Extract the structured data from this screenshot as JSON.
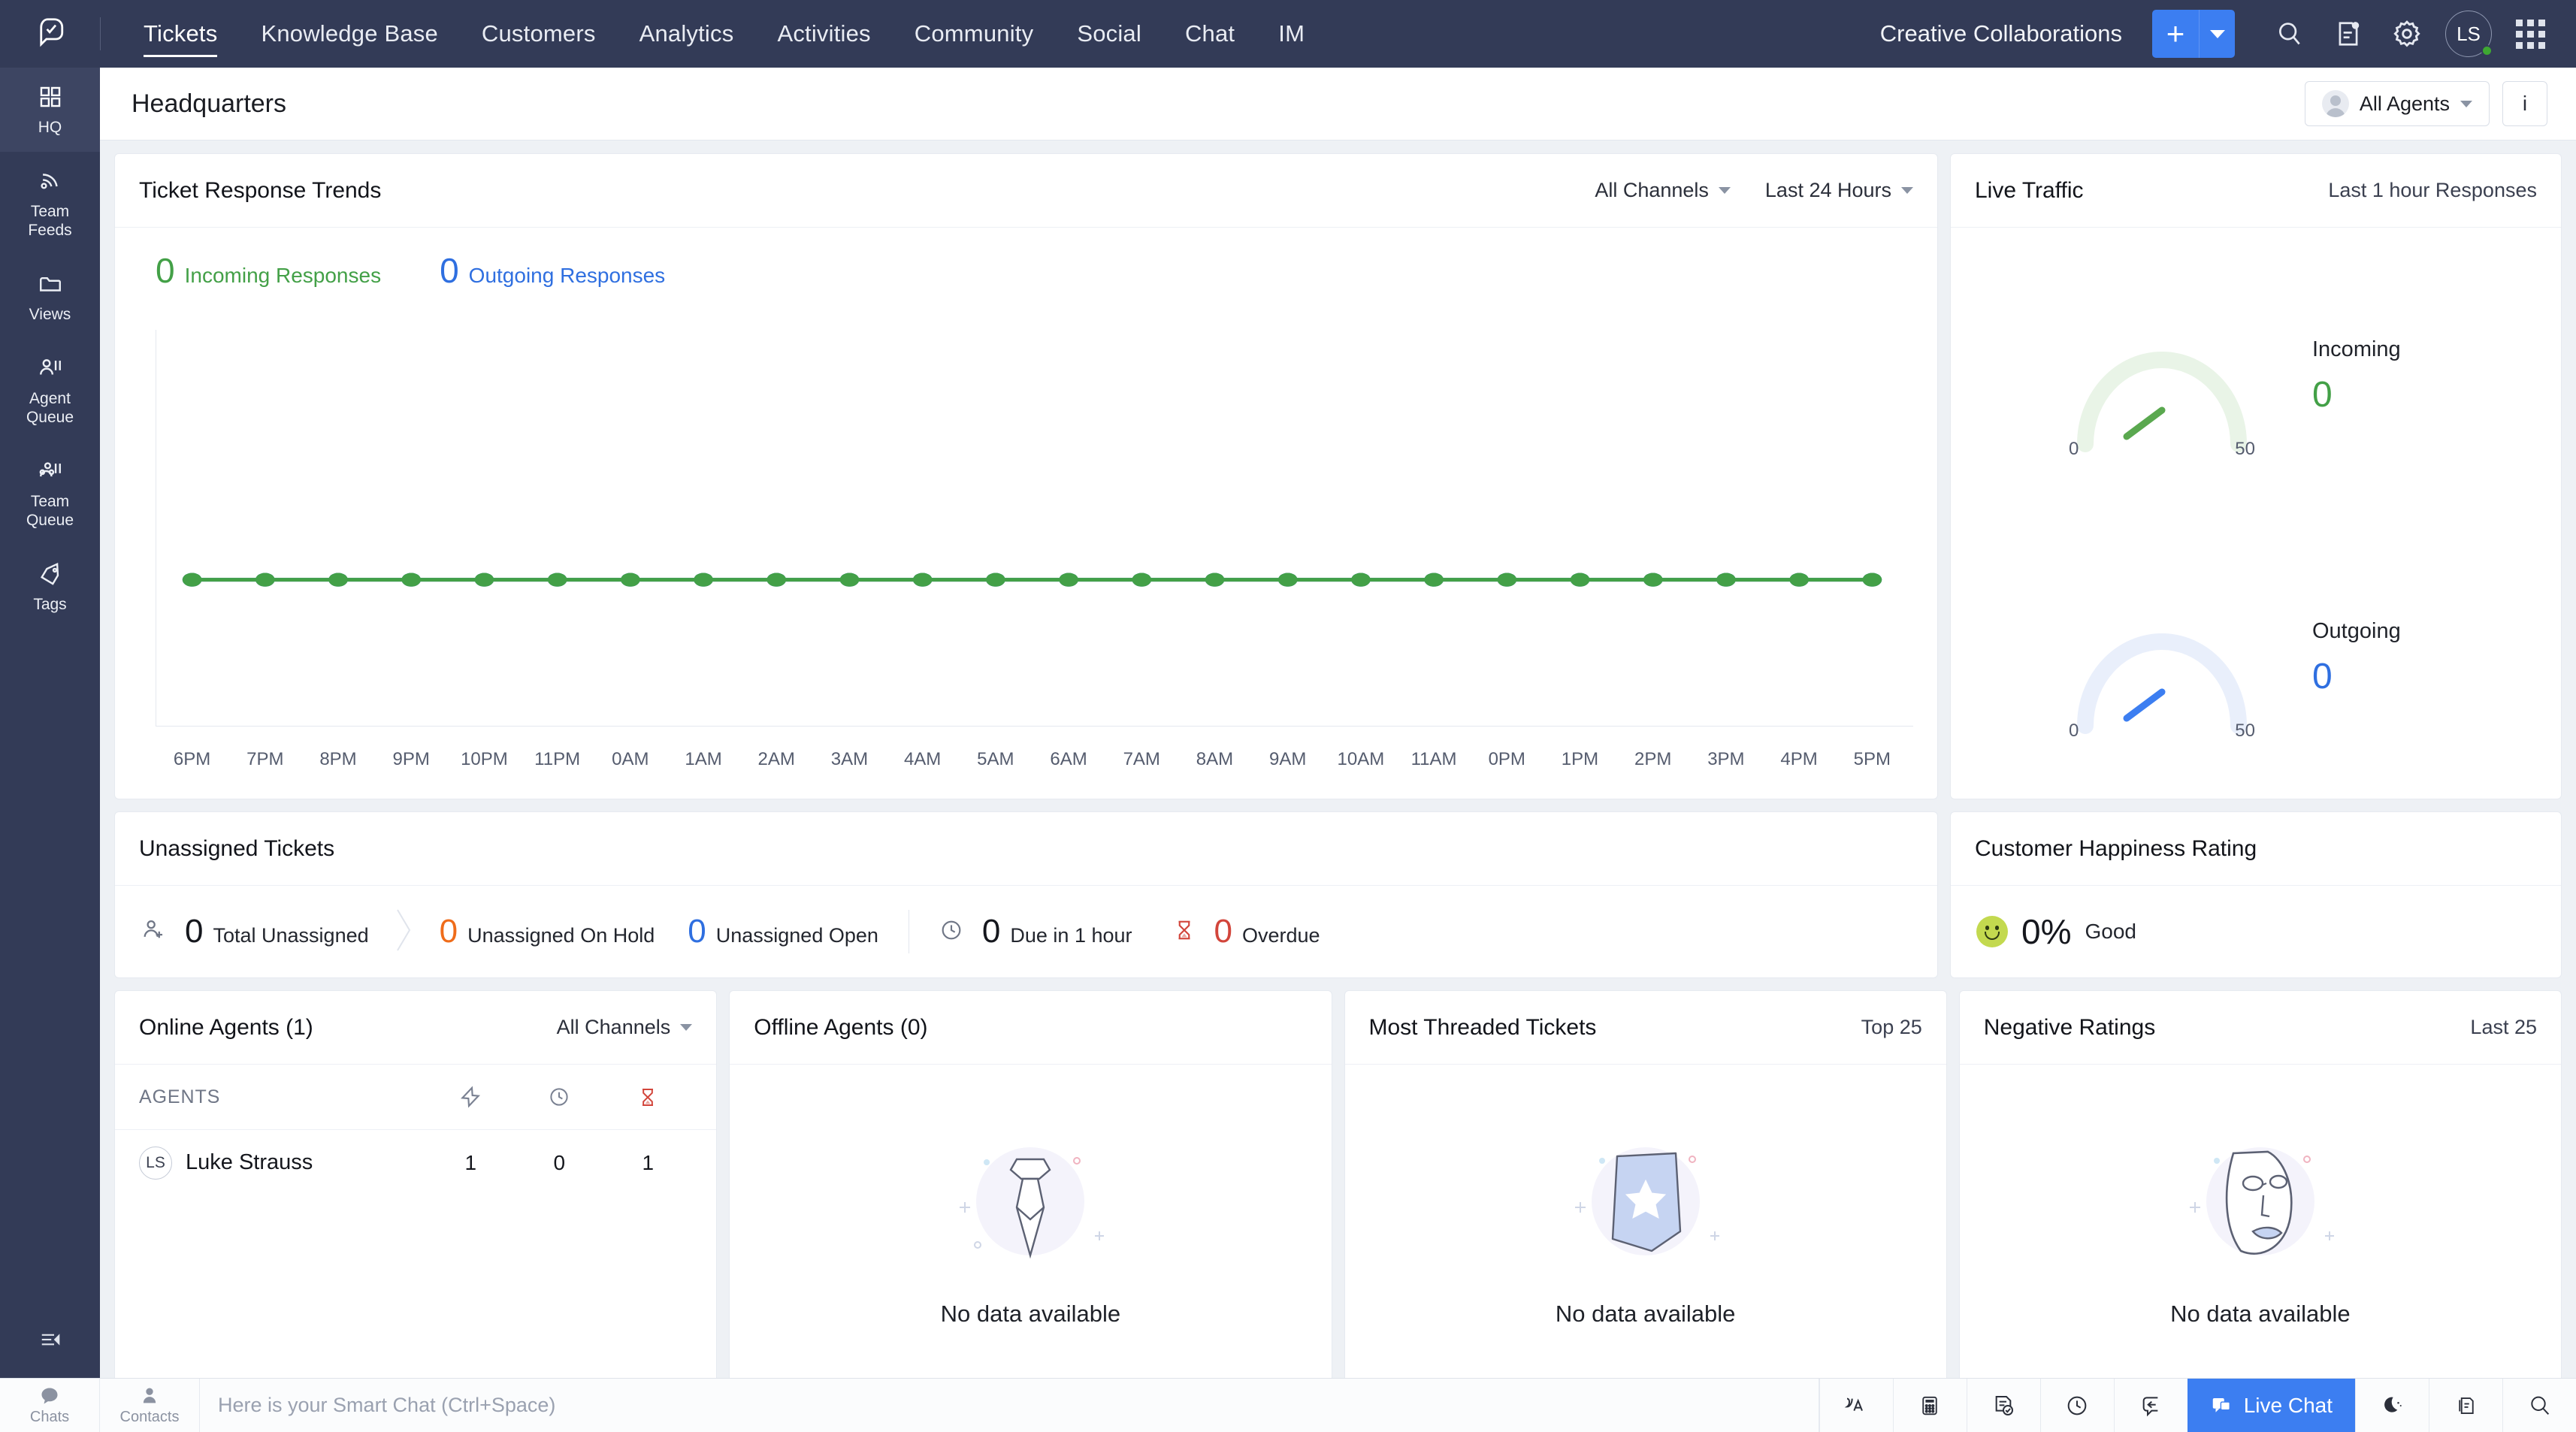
{
  "topnav": {
    "logo_icon": "ticket-chat-logo-icon",
    "items": [
      {
        "label": "Tickets",
        "active": true
      },
      {
        "label": "Knowledge Base",
        "active": false
      },
      {
        "label": "Customers",
        "active": false
      },
      {
        "label": "Analytics",
        "active": false
      },
      {
        "label": "Activities",
        "active": false
      },
      {
        "label": "Community",
        "active": false
      },
      {
        "label": "Social",
        "active": false
      },
      {
        "label": "Chat",
        "active": false
      },
      {
        "label": "IM",
        "active": false
      }
    ],
    "org_name": "Creative Collaborations",
    "add_label": "+",
    "accent_color": "#3c7ef1",
    "avatar_initials": "LS",
    "icons": [
      "search-icon",
      "notes-icon",
      "gear-icon",
      "apps-grid-icon"
    ]
  },
  "rail": {
    "items": [
      {
        "label": "HQ",
        "icon": "grid-squares-icon",
        "active": true
      },
      {
        "label": "Team\nFeeds",
        "icon": "rss-feed-icon",
        "active": false
      },
      {
        "label": "Views",
        "icon": "folder-icon",
        "active": false
      },
      {
        "label": "Agent\nQueue",
        "icon": "person-queue-icon",
        "active": false
      },
      {
        "label": "Team\nQueue",
        "icon": "team-queue-icon",
        "active": false
      },
      {
        "label": "Tags",
        "icon": "tag-icon",
        "active": false
      }
    ],
    "collapse_icon": "collapse-arrow-icon"
  },
  "header": {
    "title": "Headquarters",
    "all_agents_label": "All Agents",
    "info_label": "i"
  },
  "trends": {
    "title": "Ticket Response Trends",
    "channel_filter": "All Channels",
    "time_filter": "Last 24 Hours",
    "incoming_value": "0",
    "incoming_label": "Incoming Responses",
    "outgoing_value": "0",
    "outgoing_label": "Outgoing Responses"
  },
  "live_traffic": {
    "title": "Live Traffic",
    "subtitle": "Last 1 hour Responses",
    "incoming_label": "Incoming",
    "incoming_value": "0",
    "outgoing_label": "Outgoing",
    "outgoing_value": "0",
    "gauge_min": "0",
    "gauge_max": "50"
  },
  "unassigned": {
    "title": "Unassigned Tickets",
    "metrics": [
      {
        "value": "0",
        "label": "Total Unassigned",
        "color": "dark",
        "icon": "person-add-icon"
      },
      {
        "value": "0",
        "label": "Unassigned On Hold",
        "color": "orange",
        "icon": ""
      },
      {
        "value": "0",
        "label": "Unassigned Open",
        "color": "blue",
        "icon": ""
      },
      {
        "value": "0",
        "label": "Due in 1 hour",
        "color": "dark",
        "icon": "clock-icon"
      },
      {
        "value": "0",
        "label": "Overdue",
        "color": "red",
        "icon": "hourglass-icon"
      }
    ]
  },
  "happiness": {
    "title": "Customer Happiness Rating",
    "percent": "0%",
    "label": "Good",
    "smiley_color": "#c3d94f"
  },
  "online_agents": {
    "title": "Online Agents (1)",
    "channel_filter": "All Channels",
    "col_agents": "AGENTS",
    "col_icons": [
      "ticket-bolt-icon",
      "clock-icon",
      "hourglass-icon"
    ],
    "rows": [
      {
        "initials": "LS",
        "name": "Luke Strauss",
        "c1": "1",
        "c2": "0",
        "c3": "1"
      }
    ]
  },
  "offline_agents": {
    "title": "Offline Agents (0)",
    "empty_text": "No data available",
    "empty_icon": "necktie-illustration-icon"
  },
  "most_threaded": {
    "title": "Most Threaded Tickets",
    "subtitle": "Top 25",
    "empty_text": "No data available",
    "empty_icon": "star-badge-illustration-icon"
  },
  "negative_ratings": {
    "title": "Negative Ratings",
    "subtitle": "Last 25",
    "empty_text": "No data available",
    "empty_icon": "face-illustration-icon"
  },
  "bottombar": {
    "chats_label": "Chats",
    "contacts_label": "Contacts",
    "search_placeholder": "Here is your Smart Chat (Ctrl+Space)",
    "live_chat_label": "Live Chat",
    "right_icons": [
      "translate-icon",
      "calculator-icon",
      "tasks-icon",
      "clock-icon",
      "reply-icon",
      "moon-icon",
      "clipboard-icon",
      "search-icon"
    ]
  },
  "chart_data": {
    "type": "line",
    "title": "Ticket Response Trends",
    "xlabel": "",
    "ylabel": "",
    "ylim": [
      0,
      1
    ],
    "grid": false,
    "legend_position": "top-left",
    "categories": [
      "6PM",
      "7PM",
      "8PM",
      "9PM",
      "10PM",
      "11PM",
      "0AM",
      "1AM",
      "2AM",
      "3AM",
      "4AM",
      "5AM",
      "6AM",
      "7AM",
      "8AM",
      "9AM",
      "10AM",
      "11AM",
      "0PM",
      "1PM",
      "2PM",
      "3PM",
      "4PM",
      "5PM"
    ],
    "series": [
      {
        "name": "Incoming Responses",
        "color": "#43a047",
        "values": [
          0,
          0,
          0,
          0,
          0,
          0,
          0,
          0,
          0,
          0,
          0,
          0,
          0,
          0,
          0,
          0,
          0,
          0,
          0,
          0,
          0,
          0,
          0,
          0
        ]
      },
      {
        "name": "Outgoing Responses",
        "color": "#3c7ef1",
        "values": [
          0,
          0,
          0,
          0,
          0,
          0,
          0,
          0,
          0,
          0,
          0,
          0,
          0,
          0,
          0,
          0,
          0,
          0,
          0,
          0,
          0,
          0,
          0,
          0
        ]
      }
    ]
  },
  "gauges": [
    {
      "name": "Incoming",
      "value": 0,
      "min": 0,
      "max": 50,
      "color": "#43a047",
      "track": "#e8f3e6"
    },
    {
      "name": "Outgoing",
      "value": 0,
      "min": 0,
      "max": 50,
      "color": "#3c7ef1",
      "track": "#e8eefb"
    }
  ]
}
